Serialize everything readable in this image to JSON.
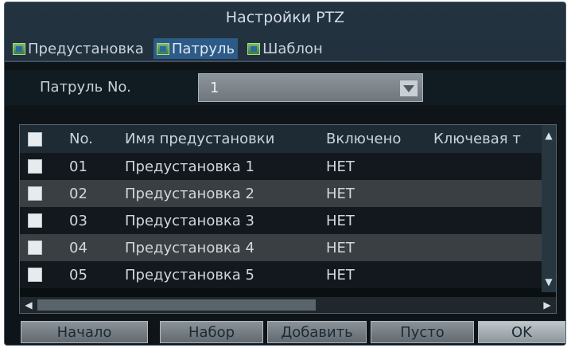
{
  "dialog": {
    "title": "Настройки PTZ",
    "tabs": [
      {
        "label": "Предустановка",
        "active": false
      },
      {
        "label": "Патруль",
        "active": true
      },
      {
        "label": "Шаблон",
        "active": false
      }
    ]
  },
  "patrol": {
    "label": "Патруль No.",
    "value": "1"
  },
  "table": {
    "headers": [
      "No.",
      "Имя предустановки",
      "Включено",
      "Ключевая т"
    ],
    "rows": [
      {
        "no": "01",
        "name": "Предустановка 1",
        "enabled": "НЕТ"
      },
      {
        "no": "02",
        "name": "Предустановка 2",
        "enabled": "НЕТ"
      },
      {
        "no": "03",
        "name": "Предустановка 3",
        "enabled": "НЕТ"
      },
      {
        "no": "04",
        "name": "Предустановка 4",
        "enabled": "НЕТ"
      },
      {
        "no": "05",
        "name": "Предустановка 5",
        "enabled": "НЕТ"
      }
    ]
  },
  "buttons": {
    "start": "Начало",
    "set": "Набор",
    "add": "Добавить",
    "clear": "Пусто",
    "ok": "OK"
  },
  "colors": {
    "background": "#0e1418",
    "active_tab": "#2c5b88",
    "row_alt": "#3a3f44"
  }
}
